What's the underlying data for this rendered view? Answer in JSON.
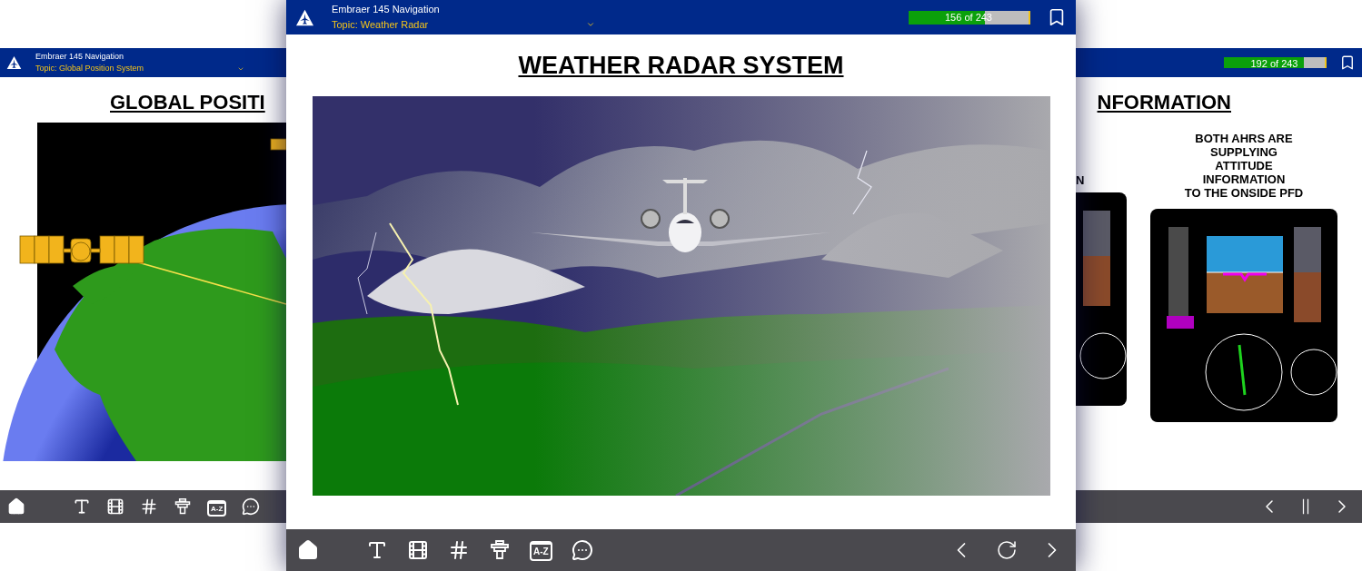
{
  "cards": [
    {
      "kind": "gps",
      "header": {
        "title": "Embraer 145 Navigation",
        "topic": "Topic: Global Position System"
      },
      "slide_title": "GLOBAL POSITI",
      "toolbar": [
        {
          "kind": "home"
        },
        {
          "kind": "text"
        },
        {
          "kind": "video"
        },
        {
          "kind": "hash"
        },
        {
          "kind": "podium"
        },
        {
          "kind": "glossary",
          "label": "A-Z"
        },
        {
          "kind": "chat"
        }
      ]
    },
    {
      "kind": "radar",
      "header": {
        "title": "Embraer 145 Navigation",
        "topic": "Topic: Weather Radar"
      },
      "progress": {
        "text": "156 of 243",
        "level": 0.64
      },
      "slide_title": "WEATHER RADAR SYSTEM",
      "toolbar": [
        {
          "kind": "home"
        },
        {
          "kind": "text"
        },
        {
          "kind": "video"
        },
        {
          "kind": "hash"
        },
        {
          "kind": "podium"
        },
        {
          "kind": "glossary",
          "label": "A-Z"
        },
        {
          "kind": "chat"
        },
        {
          "kind": "prev"
        },
        {
          "kind": "refresh"
        },
        {
          "kind": "next"
        }
      ]
    },
    {
      "kind": "ahrs",
      "progress": {
        "text": "192 of 243",
        "level": 0.79
      },
      "slide_title": "NFORMATION",
      "fragment": "N",
      "caption": [
        "BOTH AHRS ARE",
        "SUPPLYING",
        "ATTITUDE",
        "INFORMATION",
        "TO THE ONSIDE PFD"
      ],
      "toolbar": [
        {
          "kind": "prev"
        },
        {
          "kind": "pause"
        },
        {
          "kind": "next"
        }
      ]
    }
  ]
}
